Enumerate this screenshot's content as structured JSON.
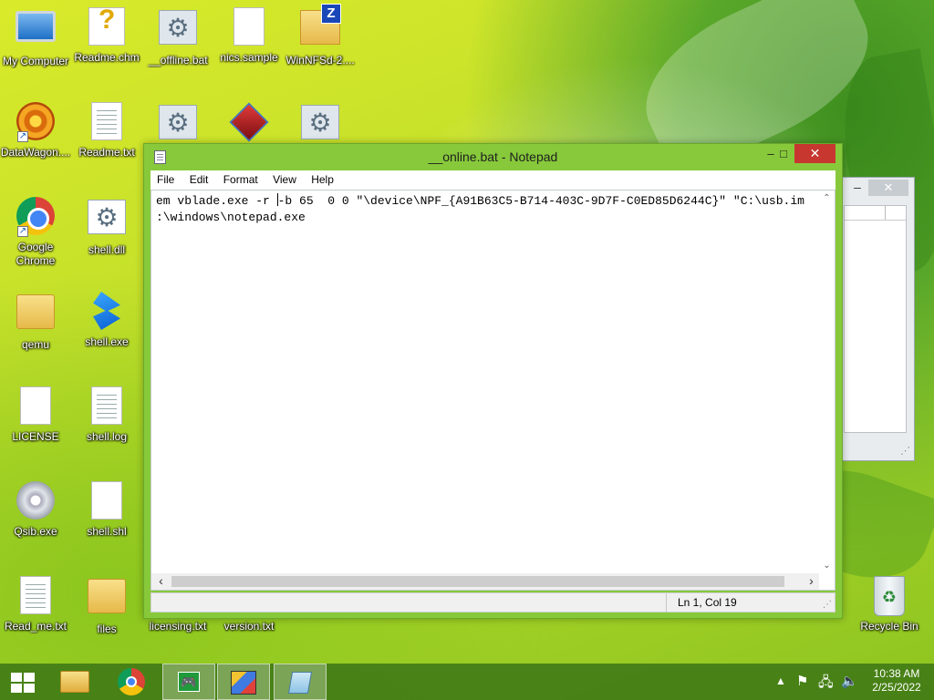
{
  "desktop": {
    "icons": [
      {
        "label": "My Computer",
        "icon": "computer-icon"
      },
      {
        "label": "Readme.chm",
        "icon": "help-file-icon"
      },
      {
        "label": "__offline.bat",
        "icon": "batch-file-icon"
      },
      {
        "label": "nics.sample",
        "icon": "file-icon"
      },
      {
        "label": "WinNFSd-2....",
        "icon": "zip-folder-icon"
      },
      {
        "label": "DataWagon....",
        "icon": "app-icon"
      },
      {
        "label": "Readme.txt",
        "icon": "text-file-icon"
      },
      {
        "label": "Google Chrome",
        "icon": "chrome-icon"
      },
      {
        "label": "shell.dll",
        "icon": "dll-file-icon"
      },
      {
        "label": "qemu",
        "icon": "folder-icon"
      },
      {
        "label": "shell.exe",
        "icon": "exe-icon"
      },
      {
        "label": "LICENSE",
        "icon": "file-icon"
      },
      {
        "label": "shell.log",
        "icon": "text-file-icon"
      },
      {
        "label": "Qsib.exe",
        "icon": "disc-icon"
      },
      {
        "label": "shell.shl",
        "icon": "file-icon"
      },
      {
        "label": "Read_me.txt",
        "icon": "text-file-icon"
      },
      {
        "label": "files",
        "icon": "folder-icon"
      },
      {
        "label": "licensing.txt",
        "icon": "text-file-icon"
      },
      {
        "label": "version.txt",
        "icon": "text-file-icon"
      },
      {
        "label": "Recycle Bin",
        "icon": "recycle-bin-icon"
      }
    ]
  },
  "notepad": {
    "title": "__online.bat - Notepad",
    "menu": [
      "File",
      "Edit",
      "Format",
      "View",
      "Help"
    ],
    "line1_before_caret": "em vblade.exe -r ",
    "line1_after_caret": "-b 65  0 0 \"\\device\\NPF_{A91B63C5-B714-403C-9D7F-C0ED85D6244C}\" \"C:\\usb.im",
    "line2": ":\\windows\\notepad.exe",
    "status_position": "Ln 1, Col 19",
    "controls": {
      "minimize": "–",
      "maximize": "□",
      "close": "✕"
    }
  },
  "background_window": {
    "minimize": "–",
    "close": "✕"
  },
  "taskbar": {
    "buttons": [
      "start-button",
      "file-explorer",
      "google-chrome",
      "xbox-app",
      "shapes-app",
      "notepad"
    ],
    "clock_time": "10:38 AM",
    "clock_date": "2/25/2022"
  },
  "colors": {
    "accent": "#87c93b",
    "taskbar": "#3e7814",
    "close_button": "#c7372f"
  }
}
